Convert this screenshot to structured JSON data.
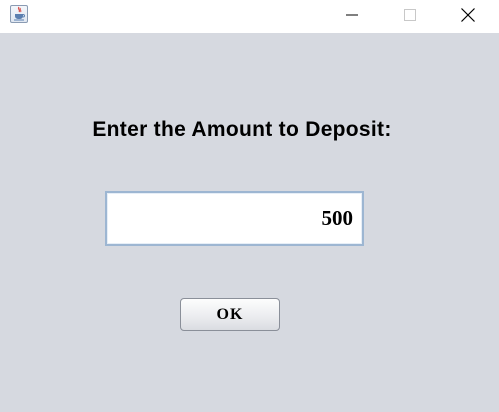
{
  "window": {
    "title_controls": {
      "minimize_icon": "minimize-icon",
      "maximize_icon": "maximize-icon",
      "close_icon": "close-icon"
    },
    "app_icon": "java-cup-icon"
  },
  "dialog": {
    "prompt": "Enter the Amount to Deposit:",
    "amount_value": "500",
    "ok_label": "OK"
  },
  "colors": {
    "background": "#d6d9e0",
    "titlebar": "#ffffff",
    "field_border": "#9db6d2"
  }
}
